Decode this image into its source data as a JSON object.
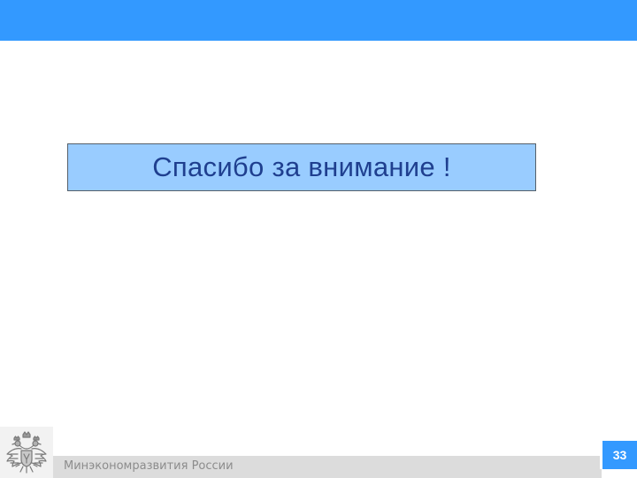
{
  "slide": {
    "title": "Спасибо за внимание !",
    "footer_org": "Минэкономразвития России",
    "page_number": "33"
  },
  "colors": {
    "header_bar": "#3399ff",
    "title_box_bg": "#99ccff",
    "title_text": "#1f3f8f",
    "footer_bar": "#dcdcdc",
    "footer_text": "#8c8c8c",
    "page_badge": "#3399ff"
  },
  "icons": {
    "emblem": "russian-coat-of-arms-icon"
  }
}
